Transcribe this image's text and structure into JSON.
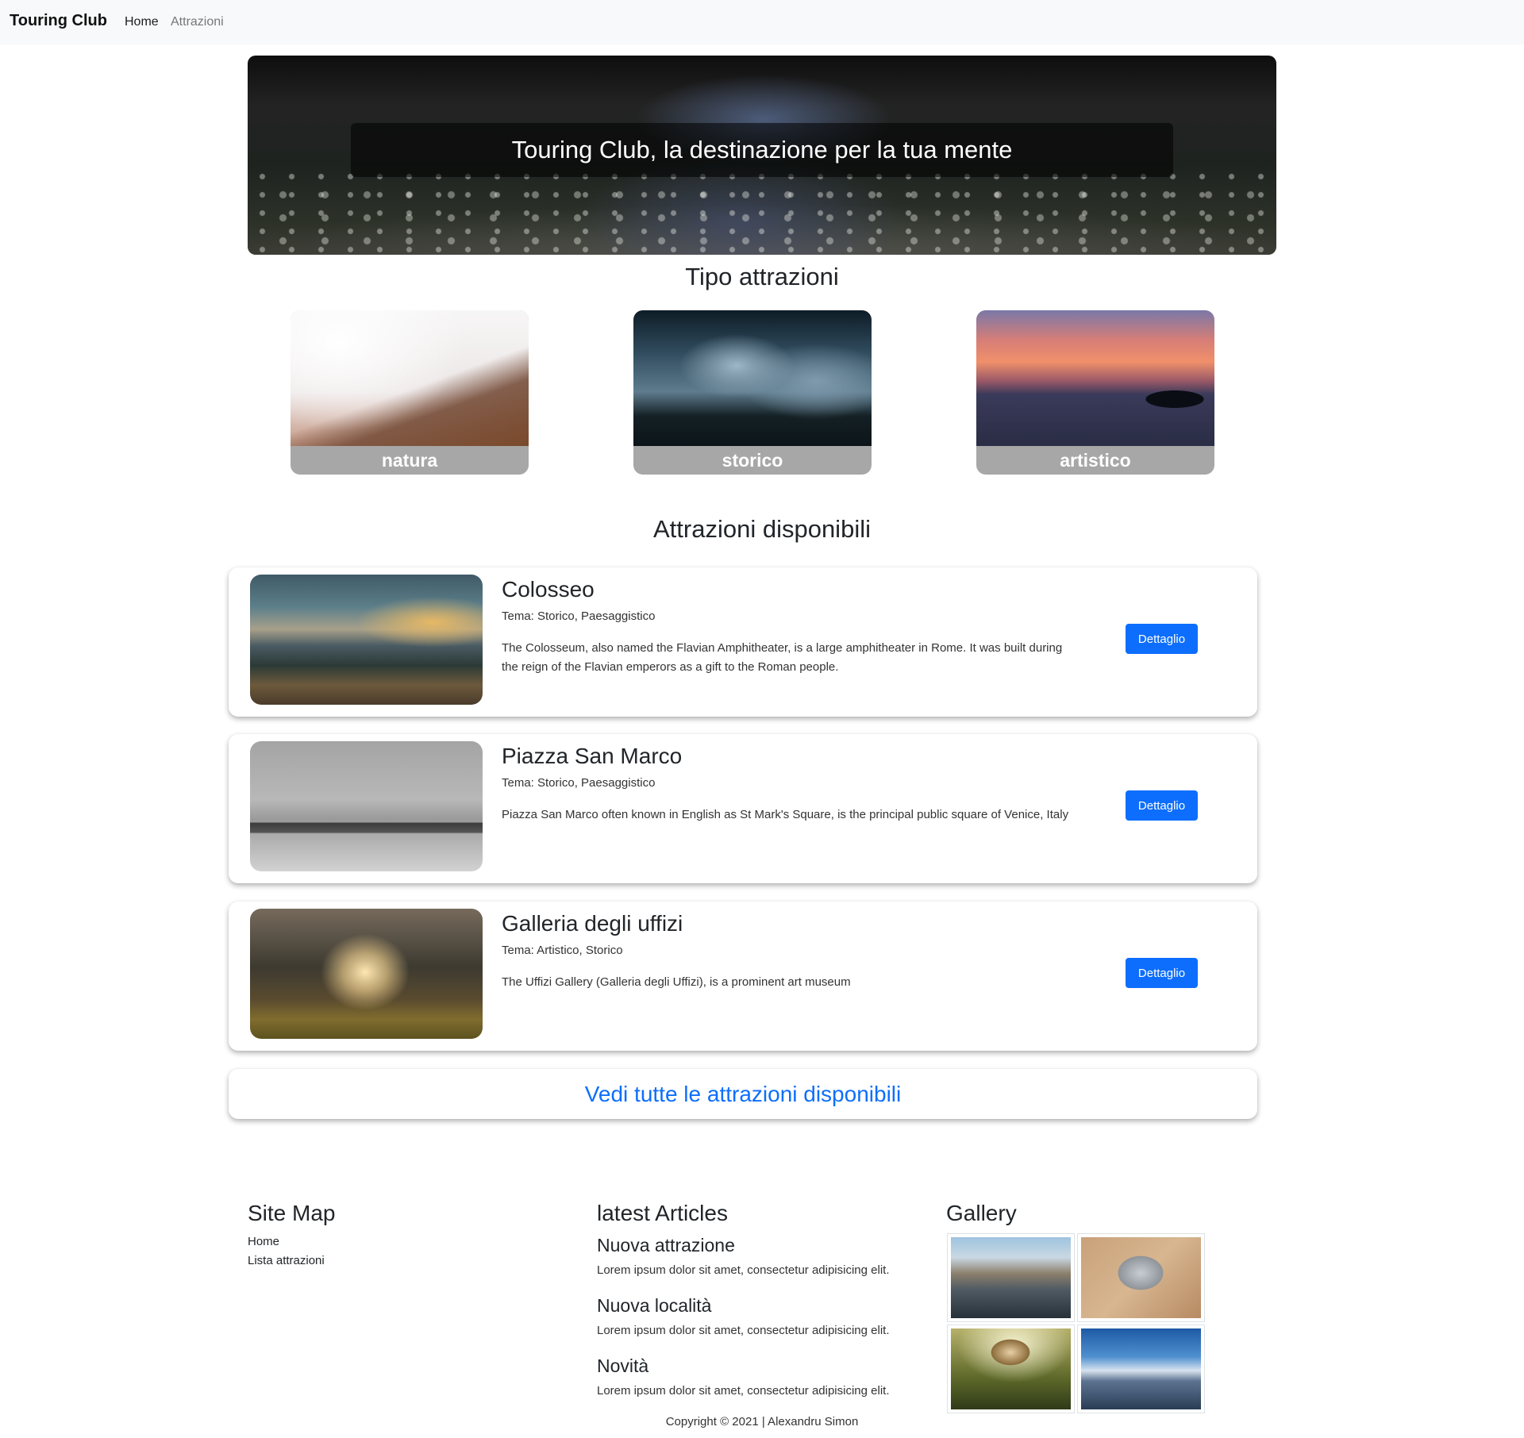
{
  "navbar": {
    "brand": "Touring Club",
    "links": [
      "Home",
      "Attrazioni"
    ]
  },
  "hero": {
    "title": "Touring Club, la destinazione per la tua mente"
  },
  "types": {
    "title": "Tipo attrazioni",
    "categories": [
      {
        "label": "natura"
      },
      {
        "label": "storico"
      },
      {
        "label": "artistico"
      }
    ]
  },
  "attractions": {
    "title": "Attrazioni disponibili",
    "items": [
      {
        "name": "Colosseo",
        "tema": "Tema: Storico, Paesaggistico",
        "description": "The Colosseum, also named the Flavian Amphitheater, is a large amphitheater in Rome. It was built during the reign of the Flavian emperors as a gift to the Roman people.",
        "button": "Dettaglio"
      },
      {
        "name": "Piazza San Marco",
        "tema": "Tema: Storico, Paesaggistico",
        "description": "Piazza San Marco often known in English as St Mark's Square, is the principal public square of Venice, Italy",
        "button": "Dettaglio"
      },
      {
        "name": "Galleria degli uffizi",
        "tema": "Tema: Artistico, Storico",
        "description": "The Uffizi Gallery (Galleria degli Uffizi), is a prominent art museum",
        "button": "Dettaglio"
      }
    ],
    "see_all": "Vedi tutte le attrazioni disponibili"
  },
  "footer": {
    "sitemap": {
      "title": "Site Map",
      "links": [
        "Home",
        "Lista attrazioni"
      ]
    },
    "articles": {
      "title": "latest Articles",
      "items": [
        {
          "title": "Nuova attrazione",
          "text": "Lorem ipsum dolor sit amet, consectetur adipisicing elit."
        },
        {
          "title": "Nuova località",
          "text": "Lorem ipsum dolor sit amet, consectetur adipisicing elit."
        },
        {
          "title": "Novità",
          "text": "Lorem ipsum dolor sit amet, consectetur adipisicing elit."
        }
      ]
    },
    "gallery": {
      "title": "Gallery"
    },
    "copyright": "Copyright © 2021 | Alexandru Simon"
  },
  "colors": {
    "primary": "#0d6efd",
    "navbar_bg": "#f8f9fa",
    "category_label_bg": "#a7a7a7"
  }
}
